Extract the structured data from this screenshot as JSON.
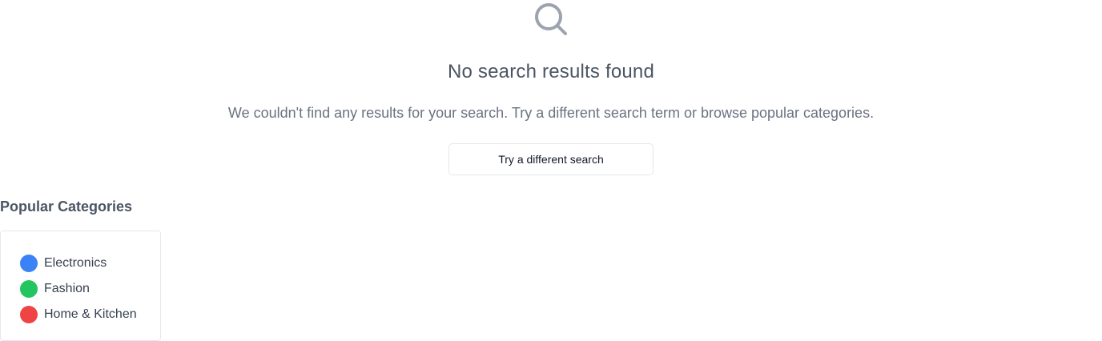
{
  "empty_state": {
    "icon": "search-icon",
    "title": "No search results found",
    "message": "We couldn't find any results for your search. Try a different search term or browse popular categories.",
    "button_label": "Try a different search"
  },
  "categories": {
    "heading": "Popular Categories",
    "items": [
      {
        "label": "Electronics",
        "color": "#3b82f6"
      },
      {
        "label": "Fashion",
        "color": "#22c55e"
      },
      {
        "label": "Home & Kitchen",
        "color": "#ef4444"
      }
    ]
  },
  "colors": {
    "icon": "#9ca3af",
    "border": "#e5e7eb"
  }
}
